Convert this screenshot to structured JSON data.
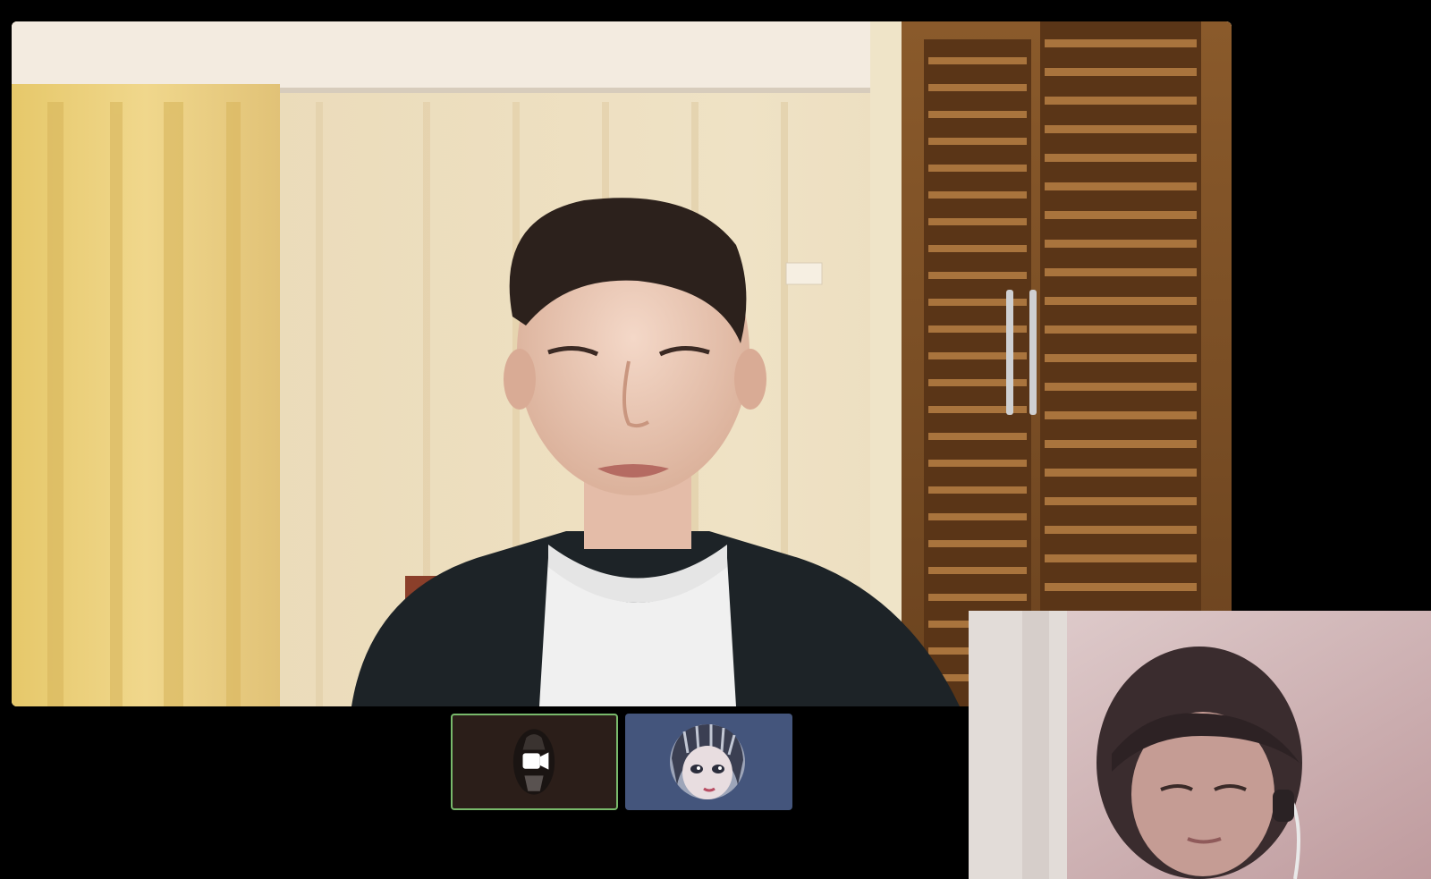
{
  "meeting": {
    "main_participant": {
      "video_state": "camera-on",
      "scene": "speaker-video"
    },
    "thumbnails": [
      {
        "kind": "video-off-avatar",
        "icon": "video-camera-icon",
        "accent": "#78b96b",
        "background": "#2b1e19",
        "active": true
      },
      {
        "kind": "avatar",
        "icon": "anime-avatar-icon",
        "background": "#44557c",
        "active": false
      }
    ],
    "self_view": {
      "video_state": "camera-on",
      "scene": "self-video"
    }
  },
  "colors": {
    "background": "#000000",
    "active_border": "#78b96b",
    "avatar_tile": "#44557c",
    "camera_tile": "#2b1e19"
  }
}
